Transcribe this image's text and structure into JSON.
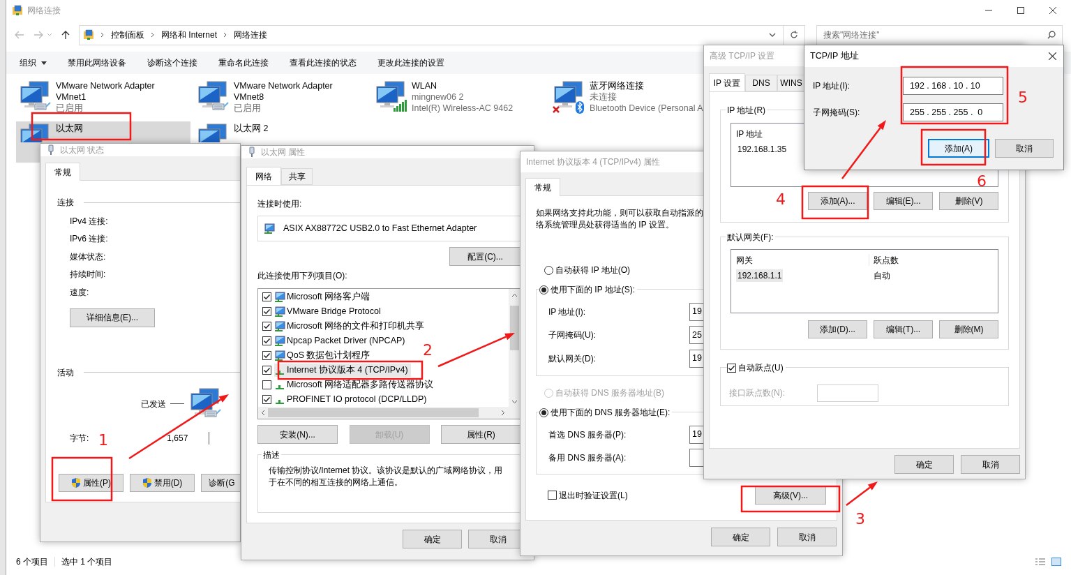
{
  "explorer": {
    "title": "网络连接",
    "breadcrumb": [
      "控制面板",
      "网络和 Internet",
      "网络连接"
    ],
    "search": {
      "placeholder": "搜索\"网络连接\""
    },
    "toolbar": [
      {
        "label": "组织",
        "dropdown": true
      },
      {
        "label": "禁用此网络设备",
        "dropdown": false
      },
      {
        "label": "诊断这个连接",
        "dropdown": false
      },
      {
        "label": "重命名此连接",
        "dropdown": false
      },
      {
        "label": "查看此连接的状态",
        "dropdown": false
      },
      {
        "label": "更改此连接的设置",
        "dropdown": false
      }
    ],
    "connections": [
      {
        "name": "VMware Network Adapter VMnet1",
        "status": "已启用",
        "kind": "wired",
        "selected": false
      },
      {
        "name": "VMware Network Adapter VMnet8",
        "status": "已启用",
        "kind": "wired",
        "selected": false
      },
      {
        "name": "WLAN",
        "status": "mingnew06 2",
        "device": "Intel(R) Wireless-AC 9462",
        "kind": "wifi",
        "selected": false
      },
      {
        "name": "蓝牙网络连接",
        "status": "未连接",
        "device": "Bluetooth Device (Personal A",
        "kind": "bluetooth",
        "selected": false
      },
      {
        "name": "以太网",
        "kind": "wired",
        "selected": true
      },
      {
        "name": "以太网 2",
        "kind": "wired",
        "selected": false
      }
    ],
    "status_bar": [
      "6 个项目",
      "选中 1 个项目"
    ]
  },
  "status_dialog": {
    "title": "以太网 状态",
    "tabs": [
      {
        "label": "常规",
        "selected": true
      }
    ],
    "connection_heading": "连接",
    "fields": [
      "IPv4 连接:",
      "IPv6 连接:",
      "媒体状态:",
      "持续时间:",
      "速度:"
    ],
    "details_button": "详细信息(E)...",
    "activity_heading": "活动",
    "sent_label": "已发送",
    "bytes_label": "字节:",
    "bytes_sent": "1,657",
    "buttons": [
      {
        "label": "属性(P)",
        "shield": true
      },
      {
        "label": "禁用(D)",
        "shield": true
      },
      {
        "label": "诊断(G",
        "shield": false
      }
    ]
  },
  "properties_dialog": {
    "title": "以太网 属性",
    "tabs": [
      {
        "label": "网络",
        "selected": true
      },
      {
        "label": "共享",
        "selected": false
      }
    ],
    "connect_using_label": "连接时使用:",
    "adapter": "ASIX AX88772C USB2.0 to Fast Ethernet Adapter",
    "configure_button": "配置(C)...",
    "items_label": "此连接使用下列项目(O):",
    "items": [
      {
        "label": "Microsoft 网络客户端",
        "checked": true,
        "kind": "client",
        "selected": false
      },
      {
        "label": "VMware Bridge Protocol",
        "checked": true,
        "kind": "client",
        "selected": false
      },
      {
        "label": "Microsoft 网络的文件和打印机共享",
        "checked": true,
        "kind": "client",
        "selected": false
      },
      {
        "label": "Npcap Packet Driver (NPCAP)",
        "checked": true,
        "kind": "client",
        "selected": false
      },
      {
        "label": "QoS 数据包计划程序",
        "checked": true,
        "kind": "client",
        "selected": false
      },
      {
        "label": "Internet 协议版本 4 (TCP/IPv4)",
        "checked": true,
        "kind": "protocol",
        "selected": true
      },
      {
        "label": "Microsoft 网络适配器多路传送器协议",
        "checked": false,
        "kind": "protocol",
        "selected": false
      },
      {
        "label": "PROFINET IO protocol (DCP/LLDP)",
        "checked": true,
        "kind": "protocol",
        "selected": false
      }
    ],
    "buttons": [
      {
        "label": "安装(N)...",
        "disabled": false
      },
      {
        "label": "卸载(U)",
        "disabled": true
      },
      {
        "label": "属性(R)",
        "disabled": false
      }
    ],
    "description_heading": "描述",
    "description": "传输控制协议/Internet 协议。该协议是默认的广域网络协议，用于在不同的相互连接的网络上通信。",
    "ok": "确定",
    "cancel": "取消"
  },
  "ipv4_dialog": {
    "title": "Internet 协议版本 4 (TCP/IPv4) 属性",
    "tabs": [
      {
        "label": "常规",
        "selected": true
      }
    ],
    "intro": [
      "如果网络支持此功能，则可以获取自动指派的",
      "络系统管理员处获得适当的 IP 设置。"
    ],
    "ip_options": [
      {
        "label": "自动获得 IP 地址(O)",
        "selected": false,
        "disabled": false
      },
      {
        "label": "使用下面的 IP 地址(S):",
        "selected": true,
        "disabled": false
      }
    ],
    "ip_fields": [
      {
        "label": "IP 地址(I):",
        "value": "19"
      },
      {
        "label": "子网掩码(U):",
        "value": "25"
      },
      {
        "label": "默认网关(D):",
        "value": "19"
      }
    ],
    "dns_options": [
      {
        "label": "自动获得 DNS 服务器地址(B)",
        "selected": false,
        "disabled": true
      },
      {
        "label": "使用下面的 DNS 服务器地址(E):",
        "selected": true,
        "disabled": false
      }
    ],
    "dns_fields": [
      {
        "label": "首选 DNS 服务器(P):",
        "value": "19"
      },
      {
        "label": "备用 DNS 服务器(A):"
      }
    ],
    "validate": {
      "label": "退出时验证设置(L)",
      "checked": false
    },
    "advanced_button": "高级(V)...",
    "ok": "确定",
    "cancel": "取消"
  },
  "advanced_dialog": {
    "title": "高级 TCP/IP 设置",
    "tabs": [
      {
        "label": "IP 设置",
        "selected": true
      },
      {
        "label": "DNS",
        "selected": false
      },
      {
        "label": "WINS",
        "selected": false
      }
    ],
    "ip_group": "IP 地址(R)",
    "ip_list": {
      "columns": [
        "IP 地址"
      ],
      "rows": [
        {
          "cells": [
            "192.168.1.35"
          ],
          "selected": false
        }
      ]
    },
    "ip_buttons": [
      "添加(A)...",
      "编辑(E)...",
      "删除(V)"
    ],
    "gateway_group": "默认网关(F):",
    "gateway_list": {
      "columns": [
        "网关",
        "跃点数"
      ],
      "rows": [
        {
          "cells": [
            "192.168.1.1",
            "自动"
          ],
          "selected": true
        }
      ]
    },
    "gateway_buttons": [
      "添加(D)...",
      "编辑(T)...",
      "删除(M)"
    ],
    "auto_metric": {
      "label": "自动跃点(U)",
      "checked": true
    },
    "metric_label": "接口跃点数(N):",
    "ok": "确定",
    "cancel": "取消"
  },
  "address_dialog": {
    "title": "TCP/IP 地址",
    "fields": [
      {
        "label": "IP 地址(I):",
        "value": "192 . 168 . 10 . 10"
      },
      {
        "label": "子网掩码(S):",
        "value": "255 . 255 . 255 .  0"
      }
    ],
    "buttons": [
      {
        "label": "添加(A)",
        "focused": true
      },
      {
        "label": "取消",
        "focused": false
      }
    ]
  },
  "annotations": [
    {
      "label": "1"
    },
    {
      "label": "2"
    },
    {
      "label": "3"
    },
    {
      "label": "4"
    },
    {
      "label": "5"
    },
    {
      "label": "6"
    }
  ]
}
